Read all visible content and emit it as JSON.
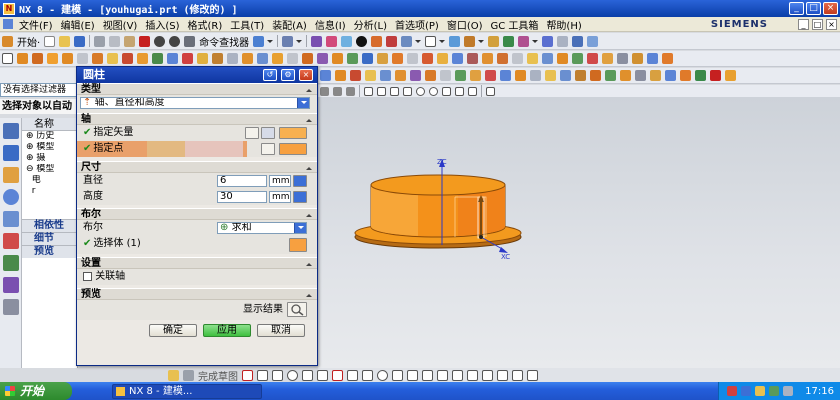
{
  "window": {
    "title": "NX 8 - 建模 - [youhugai.prt  (修改的) ]",
    "brand": "SIEMENS"
  },
  "menu": {
    "items": [
      "文件(F)",
      "编辑(E)",
      "视图(V)",
      "插入(S)",
      "格式(R)",
      "工具(T)",
      "装配(A)",
      "信息(I)",
      "分析(L)",
      "首选项(P)",
      "窗口(O)",
      "GC 工具箱",
      "帮助(H)"
    ]
  },
  "toolbar": {
    "start_label": "开始·",
    "command_finder_label": "命令查找器"
  },
  "selection": {
    "filter_label": "没有选择过滤器",
    "prompt": "选择对象以自动"
  },
  "navigator": {
    "header": "名称",
    "tree": [
      "历史",
      "模型",
      "摄",
      "模型",
      "电",
      "r"
    ],
    "dependencies_label": "相依性",
    "details_label": "细节",
    "preview_label": "预览"
  },
  "dialog": {
    "title": "圆柱",
    "type_group": "类型",
    "type_value": "轴、直径和高度",
    "axis_group": "轴",
    "specify_vector": "指定矢量",
    "specify_point": "指定点",
    "dimensions_group": "尺寸",
    "diameter_label": "直径",
    "diameter_value": "6",
    "diameter_unit": "mm",
    "height_label": "高度",
    "height_value": "30",
    "height_unit": "mm",
    "boolean_group": "布尔",
    "boolean_label": "布尔",
    "boolean_value": "求和",
    "select_body": "选择体 (1)",
    "settings_group": "设置",
    "associative_axis": "关联轴",
    "preview_group": "预览",
    "show_result": "显示结果",
    "ok_button": "确定",
    "apply_button": "应用",
    "cancel_button": "取消"
  },
  "graphics": {
    "axis_z_label": "ZC",
    "axis_x_label": "XC"
  },
  "bottom_bar": {
    "sketch_label": "完成草图"
  },
  "taskbar": {
    "start_label": "开始",
    "task_item": "NX 8 - 建模...",
    "clock": "17:16"
  },
  "colors": {
    "accent": "#0f36a0",
    "model_orange": "#f39a1e",
    "point_highlight": "#e9a06a"
  }
}
